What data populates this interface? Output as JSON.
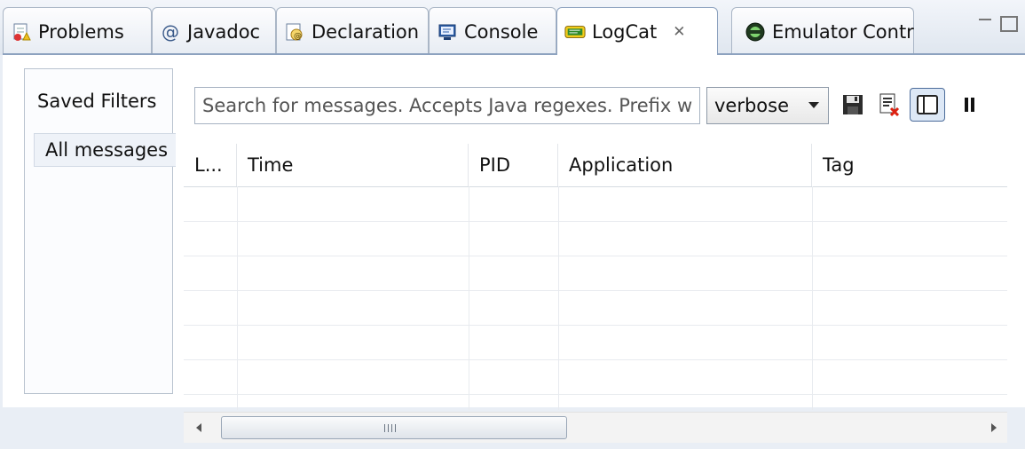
{
  "tabs": [
    {
      "label": "Problems",
      "icon": "problems-icon"
    },
    {
      "label": "Javadoc",
      "icon": "at-sign-icon"
    },
    {
      "label": "Declaration",
      "icon": "declaration-icon"
    },
    {
      "label": "Console",
      "icon": "console-icon"
    },
    {
      "label": "LogCat",
      "icon": "logcat-icon",
      "active": true
    },
    {
      "label": "Emulator Contr",
      "icon": "emulator-icon"
    }
  ],
  "sidebar": {
    "heading": "Saved Filters",
    "filters": [
      "All messages"
    ]
  },
  "search": {
    "placeholder": "Search for messages. Accepts Java regexes. Prefix wit"
  },
  "log_level": {
    "selected": "verbose"
  },
  "table": {
    "columns": [
      "L...",
      "Time",
      "PID",
      "Application",
      "Tag"
    ],
    "rows": []
  },
  "colors": {
    "active_tab_border": "#8da2bf",
    "tab_bar": "#e9eef5",
    "accent": "#4c6c9a"
  }
}
